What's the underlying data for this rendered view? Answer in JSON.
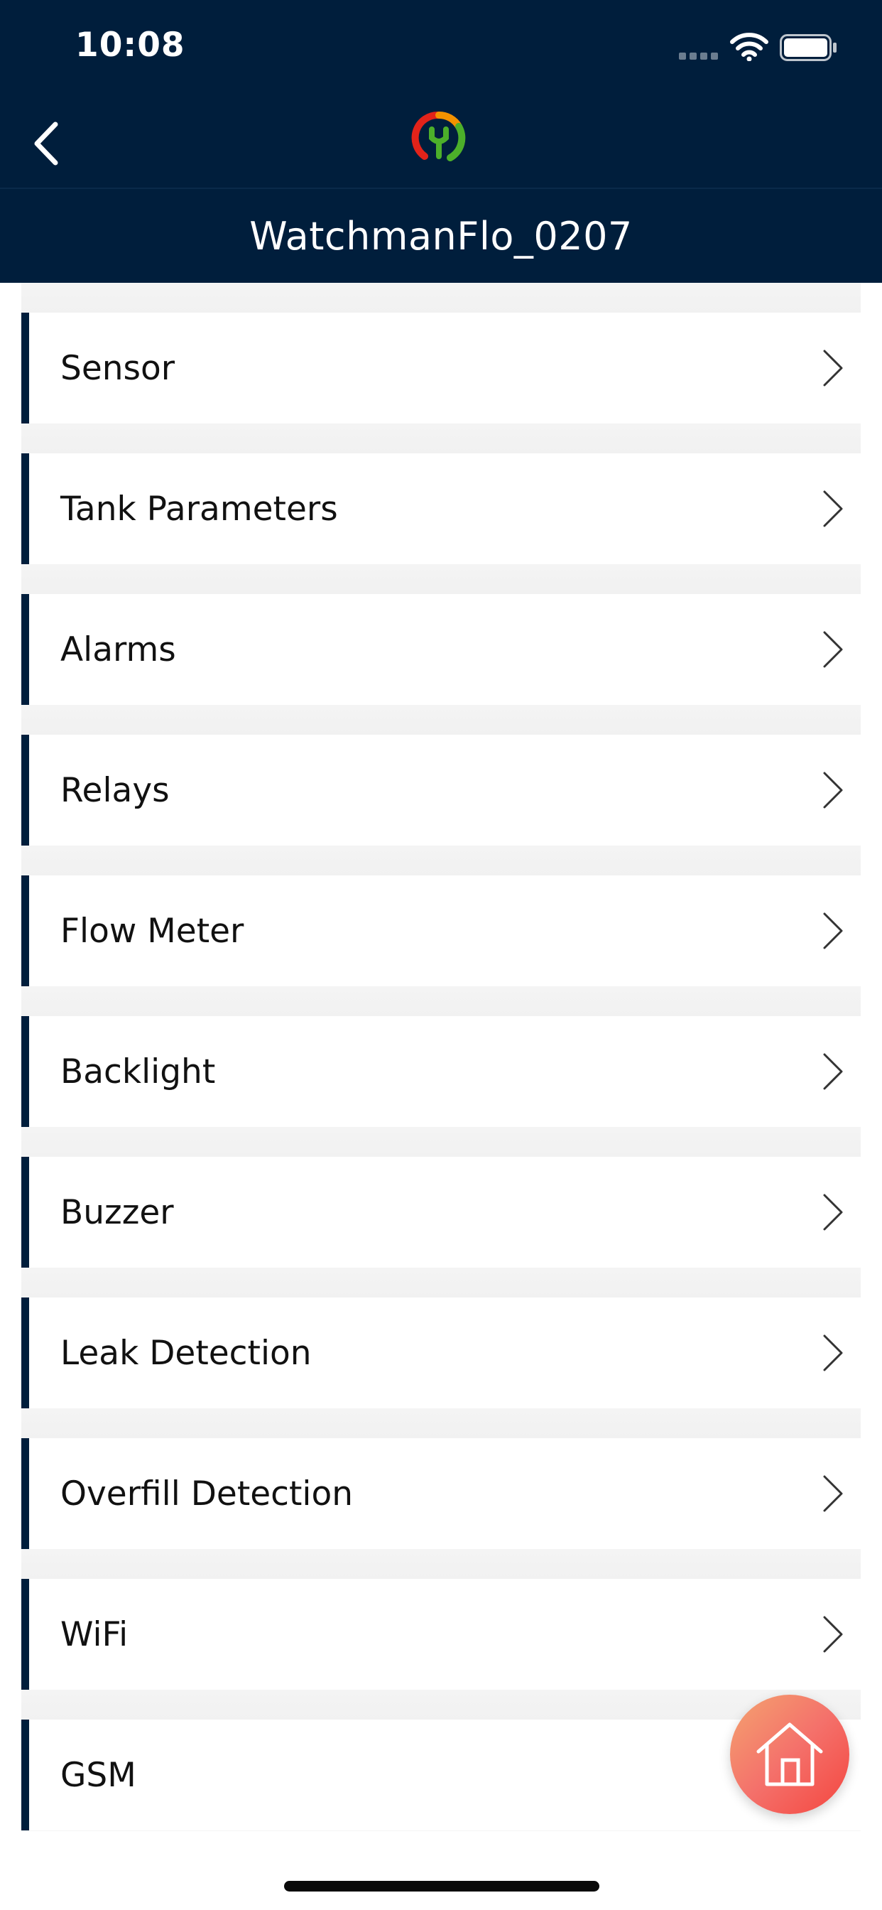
{
  "status_bar": {
    "time": "10:08",
    "icons": [
      "signal-dots-icon",
      "wifi-icon",
      "battery-icon"
    ]
  },
  "nav": {
    "back_icon": "chevron-left-icon",
    "logo_icon": "watchman-logo-icon",
    "title": "WatchmanFlo_0207"
  },
  "settings": {
    "items": [
      {
        "label": "Sensor"
      },
      {
        "label": "Tank Parameters"
      },
      {
        "label": "Alarms"
      },
      {
        "label": "Relays"
      },
      {
        "label": "Flow Meter"
      },
      {
        "label": "Backlight"
      },
      {
        "label": "Buzzer"
      },
      {
        "label": "Leak Detection"
      },
      {
        "label": "Overfill Detection"
      },
      {
        "label": "WiFi"
      },
      {
        "label": "GSM"
      }
    ]
  },
  "home_button": {
    "icon": "home-icon"
  },
  "colors": {
    "header_bg": "#001e3c",
    "accent_bar": "#001e3c",
    "fab_gradient_start": "#f4a36f",
    "fab_gradient_end": "#f4463f"
  }
}
